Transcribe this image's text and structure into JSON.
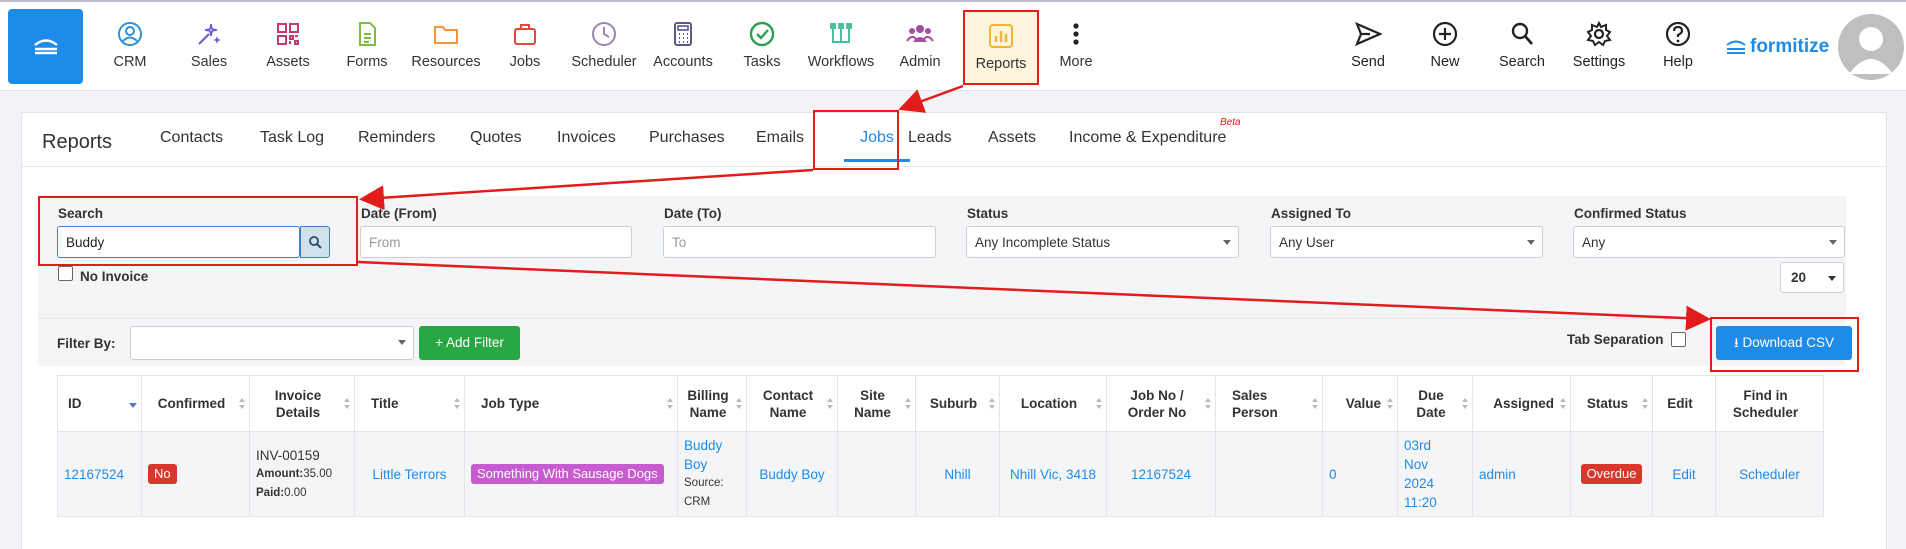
{
  "nav": {
    "items": [
      {
        "label": "CRM",
        "icon": "crm-icon"
      },
      {
        "label": "Sales",
        "icon": "sales-icon"
      },
      {
        "label": "Assets",
        "icon": "assets-icon"
      },
      {
        "label": "Forms",
        "icon": "forms-icon"
      },
      {
        "label": "Resources",
        "icon": "resources-icon"
      },
      {
        "label": "Jobs",
        "icon": "jobs-icon"
      },
      {
        "label": "Scheduler",
        "icon": "scheduler-icon"
      },
      {
        "label": "Accounts",
        "icon": "accounts-icon"
      },
      {
        "label": "Tasks",
        "icon": "tasks-icon"
      },
      {
        "label": "Workflows",
        "icon": "workflows-icon"
      },
      {
        "label": "Admin",
        "icon": "admin-icon"
      },
      {
        "label": "Reports",
        "icon": "reports-icon"
      },
      {
        "label": "More",
        "icon": "more-icon"
      }
    ],
    "right": [
      {
        "label": "Send",
        "icon": "send-icon"
      },
      {
        "label": "New",
        "icon": "plus-icon"
      },
      {
        "label": "Search",
        "icon": "search-icon"
      },
      {
        "label": "Settings",
        "icon": "gear-icon"
      },
      {
        "label": "Help",
        "icon": "help-icon"
      }
    ],
    "brand": "formitize"
  },
  "colors": {
    "accent": "#1f8be8",
    "highlight": "#e21b1b",
    "success": "#28a745",
    "danger": "#d9372b",
    "tag": "#c75bd0"
  },
  "reports": {
    "title": "Reports",
    "tabs": [
      "Contacts",
      "Task Log",
      "Reminders",
      "Quotes",
      "Invoices",
      "Purchases",
      "Emails",
      "Jobs",
      "Leads",
      "Assets",
      "Income & Expenditure"
    ],
    "active_tab": "Jobs",
    "beta": "Beta"
  },
  "filters": {
    "search_label": "Search",
    "search_value": "Buddy",
    "date_from_label": "Date (From)",
    "date_from_placeholder": "From",
    "date_to_label": "Date (To)",
    "date_to_placeholder": "To",
    "status_label": "Status",
    "status_value": "Any Incomplete Status",
    "assigned_label": "Assigned To",
    "assigned_value": "Any User",
    "confirmed_label": "Confirmed Status",
    "confirmed_value": "Any",
    "no_invoice_label": "No Invoice",
    "page_size": "20",
    "filter_by_label": "Filter By:",
    "add_filter": "+ Add Filter",
    "tab_separation_label": "Tab Separation",
    "download_csv": "Download CSV"
  },
  "table": {
    "headers": [
      "ID",
      "Confirmed",
      "Invoice Details",
      "Title",
      "Job Type",
      "Billing Name",
      "Contact Name",
      "Site Name",
      "Suburb",
      "Location",
      "Job No / Order No",
      "Sales Person",
      "Value",
      "Due Date",
      "Assigned",
      "Status",
      "Edit",
      "Find in Scheduler"
    ],
    "rows": [
      {
        "id": "12167524",
        "confirmed": "No",
        "invoice_no": "INV-00159",
        "amount_label": "Amount:",
        "amount": "35.00",
        "paid_label": "Paid:",
        "paid": "0.00",
        "title": "Little Terrors",
        "job_type": "Something With Sausage Dogs",
        "billing_name": "Buddy Boy",
        "source_label": "Source:",
        "source": "CRM",
        "contact_name": "Buddy Boy",
        "site_name": "",
        "suburb": "Nhill",
        "location": "Nhill Vic, 3418",
        "job_no": "12167524",
        "sales_person": "",
        "value": "0",
        "due_date": "03rd Nov 2024 11:20",
        "assigned": "admin",
        "status": "Overdue",
        "edit": "Edit",
        "scheduler": "Scheduler"
      }
    ]
  }
}
